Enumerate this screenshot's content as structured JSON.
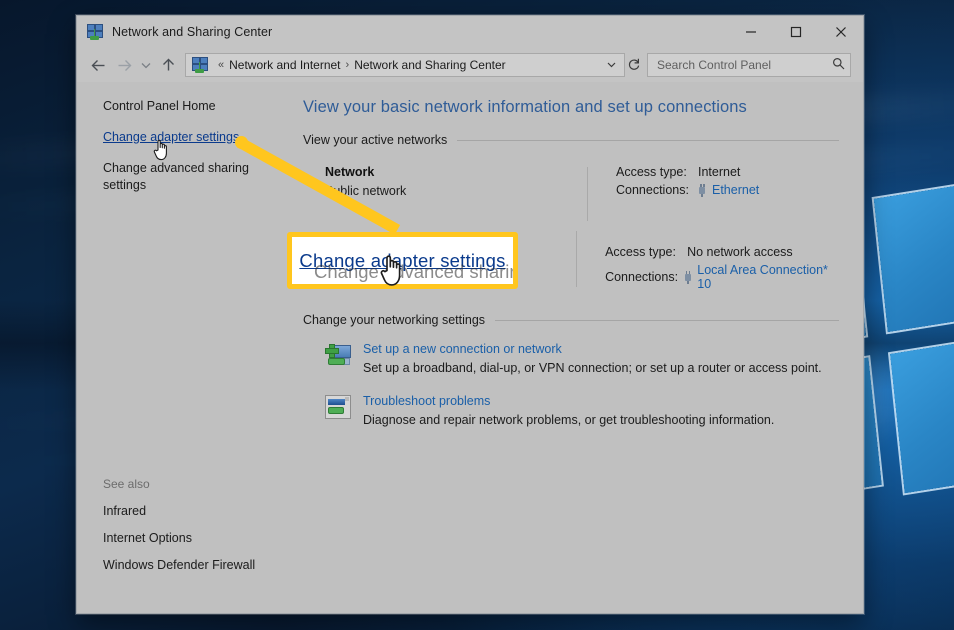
{
  "window": {
    "title": "Network and Sharing Center",
    "title_icon": "network-sharing-center-icon",
    "controls": {
      "minimize": "minimize-icon",
      "maximize": "maximize-icon",
      "close": "close-icon"
    }
  },
  "addressbar": {
    "back": "back-arrow-icon",
    "forward": "forward-arrow-icon",
    "recent": "chevron-down-icon",
    "up": "up-arrow-icon",
    "crumb_icon": "network-sharing-center-icon",
    "crumb_prefix": "«",
    "crumbs": [
      "Network and Internet",
      "Network and Sharing Center"
    ],
    "separator": "›",
    "dropdown": "chevron-down-icon",
    "refresh": "refresh-icon"
  },
  "search": {
    "placeholder": "Search Control Panel",
    "value": "",
    "icon": "search-icon"
  },
  "sidebar": {
    "items": [
      {
        "label": "Control Panel Home",
        "is_link": false
      },
      {
        "label": "Change adapter settings",
        "is_link": true
      },
      {
        "label": "Change advanced sharing settings",
        "is_link": false
      }
    ],
    "see_also": {
      "label": "See also",
      "items": [
        "Infrared",
        "Internet Options",
        "Windows Defender Firewall"
      ]
    }
  },
  "main": {
    "page_title": "View your basic network information and set up connections",
    "active_networks_heading": "View your active networks",
    "networks": [
      {
        "name": "Network",
        "type": "Public network",
        "access_type_label": "Access type:",
        "access_type_value": "Internet",
        "connections_label": "Connections:",
        "connection_name": "Ethernet",
        "connection_icon": "network-adapter-icon"
      },
      {
        "name": "",
        "type": "",
        "access_type_label": "Access type:",
        "access_type_value": "No network access",
        "connections_label": "Connections:",
        "connection_name": "Local Area Connection* 10",
        "connection_icon": "network-adapter-icon"
      }
    ],
    "change_settings_heading": "Change your networking settings",
    "tasks": [
      {
        "icon": "new-connection-icon",
        "link": "Set up a new connection or network",
        "desc": "Set up a broadband, dial-up, or VPN connection; or set up a router or access point."
      },
      {
        "icon": "troubleshoot-icon",
        "link": "Troubleshoot problems",
        "desc": "Diagnose and repair network problems, or get troubleshooting information."
      }
    ]
  },
  "annotation": {
    "callout_text": "Change adapter settings",
    "callout_ghost_text": "Change advanced sharing",
    "cursor": "hand-pointer-cursor",
    "highlight_color": "#FFC61E",
    "link_color": "#0a3a8c"
  }
}
